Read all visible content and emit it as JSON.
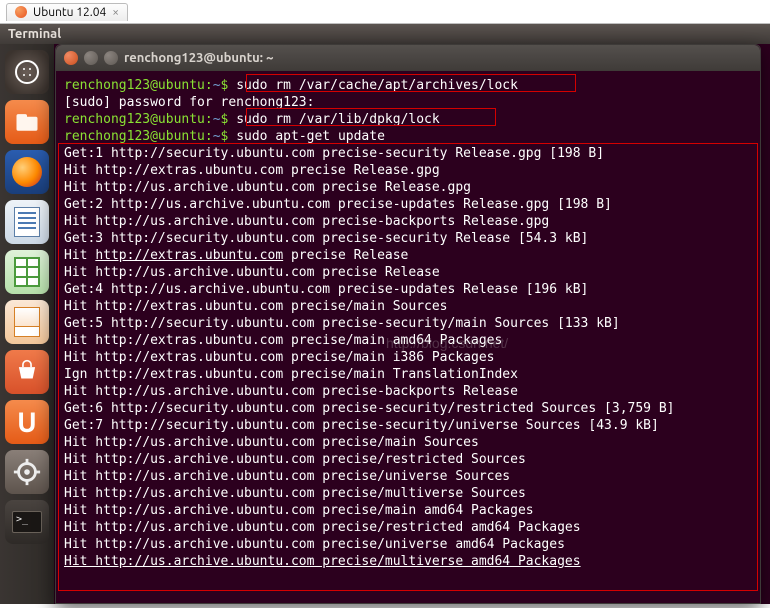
{
  "vm_tab": {
    "label": "Ubuntu 12.04"
  },
  "menu_strip": {
    "label": "Terminal"
  },
  "titlebar": {
    "title": "renchong123@ubuntu: ~"
  },
  "prompt_user_host": "renchong123@ubuntu",
  "prompt_path": "~",
  "cmds": {
    "c1": "sudo rm /var/cache/apt/archives/lock",
    "c2": "sudo rm /var/lib/dpkg/lock",
    "c3": "sudo apt-get update"
  },
  "lines": [
    "[sudo] password for renchong123:",
    "Get:1 http://security.ubuntu.com precise-security Release.gpg [198 B]",
    "Hit http://extras.ubuntu.com precise Release.gpg",
    "Hit http://us.archive.ubuntu.com precise Release.gpg",
    "Get:2 http://us.archive.ubuntu.com precise-updates Release.gpg [198 B]",
    "Hit http://us.archive.ubuntu.com precise-backports Release.gpg",
    "Get:3 http://security.ubuntu.com precise-security Release [54.3 kB]",
    "Hit http://extras.ubuntu.com precise Release",
    "Hit http://us.archive.ubuntu.com precise Release",
    "Get:4 http://us.archive.ubuntu.com precise-updates Release [196 kB]",
    "Hit http://extras.ubuntu.com precise/main Sources",
    "Get:5 http://security.ubuntu.com precise-security/main Sources [133 kB]",
    "Hit http://extras.ubuntu.com precise/main amd64 Packages",
    "Hit http://extras.ubuntu.com precise/main i386 Packages",
    "Ign http://extras.ubuntu.com precise/main TranslationIndex",
    "Hit http://us.archive.ubuntu.com precise-backports Release",
    "Get:6 http://security.ubuntu.com precise-security/restricted Sources [3,759 B]",
    "Get:7 http://security.ubuntu.com precise-security/universe Sources [43.9 kB]",
    "Hit http://us.archive.ubuntu.com precise/main Sources",
    "Hit http://us.archive.ubuntu.com precise/restricted Sources",
    "Hit http://us.archive.ubuntu.com precise/universe Sources",
    "Hit http://us.archive.ubuntu.com precise/multiverse Sources",
    "Hit http://us.archive.ubuntu.com precise/main amd64 Packages",
    "Hit http://us.archive.ubuntu.com precise/restricted amd64 Packages",
    "Hit http://us.archive.ubuntu.com precise/universe amd64 Packages",
    "Hit http://us.archive.ubuntu.com precise/multiverse amd64 Packages"
  ],
  "watermark": "http://blog.csdn.net/",
  "extras_link_text": "http://extras.ubuntu.com"
}
